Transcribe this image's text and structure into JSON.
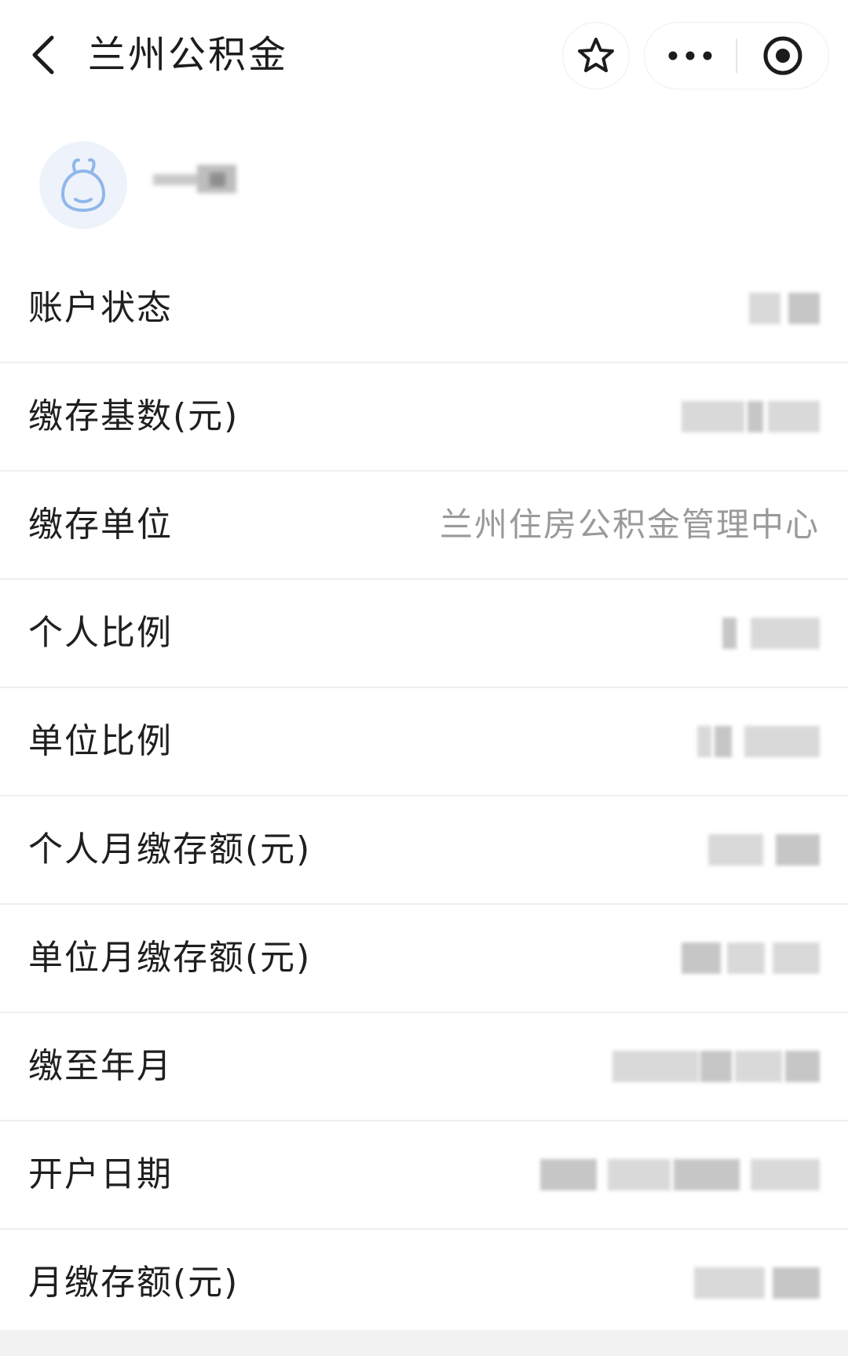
{
  "nav": {
    "back_icon": "chevron-left-icon",
    "title": "兰州公积金",
    "favorite_icon": "star-outline-icon",
    "more_icon": "more-dots-icon",
    "close_icon": "target-circle-icon"
  },
  "profile": {
    "avatar_icon": "cartoon-mascot-icon",
    "name": ""
  },
  "account": {
    "rows": [
      {
        "label": "账户状态",
        "value": ""
      },
      {
        "label": "缴存基数(元)",
        "value": ""
      },
      {
        "label": "缴存单位",
        "value": "兰州住房公积金管理中心"
      },
      {
        "label": "个人比例",
        "value": ""
      },
      {
        "label": "单位比例",
        "value": ""
      },
      {
        "label": "个人月缴存额(元)",
        "value": ""
      },
      {
        "label": "单位月缴存额(元)",
        "value": ""
      },
      {
        "label": "缴至年月",
        "value": ""
      },
      {
        "label": "开户日期",
        "value": ""
      },
      {
        "label": "月缴存额(元)",
        "value": ""
      }
    ]
  }
}
